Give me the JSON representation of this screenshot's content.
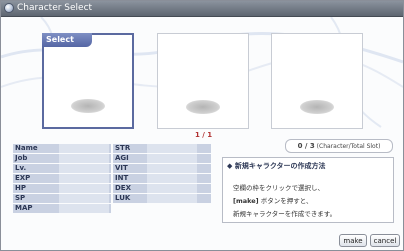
{
  "window": {
    "title": "Character Select"
  },
  "slots": [
    {
      "tab_label": "Select"
    },
    {
      "tab_label": ""
    },
    {
      "tab_label": ""
    }
  ],
  "pager": {
    "text": "1 / 1"
  },
  "slot_count": {
    "value": "0 / 3",
    "caption": "(Character/Total Slot)"
  },
  "stats_left": [
    "Name",
    "Job",
    "Lv.",
    "EXP",
    "HP",
    "SP",
    "MAP"
  ],
  "stats_right": [
    "STR",
    "AGI",
    "VIT",
    "INT",
    "DEX",
    "LUK"
  ],
  "help": {
    "title": "新規キャラクターの作成方法",
    "line1": "空欄の枠をクリックで選択し、",
    "line2_bold": "[make]",
    "line2_rest": " ボタンを押すと、",
    "line3": "新規キャラクターを作成できます。"
  },
  "buttons": {
    "make": "make",
    "cancel": "cancel"
  },
  "colors": {
    "title_bar": "#6e7681",
    "selected_border": "#5b6aa0",
    "pager_text": "#b03030",
    "stat_row": "#c9d1e2"
  }
}
